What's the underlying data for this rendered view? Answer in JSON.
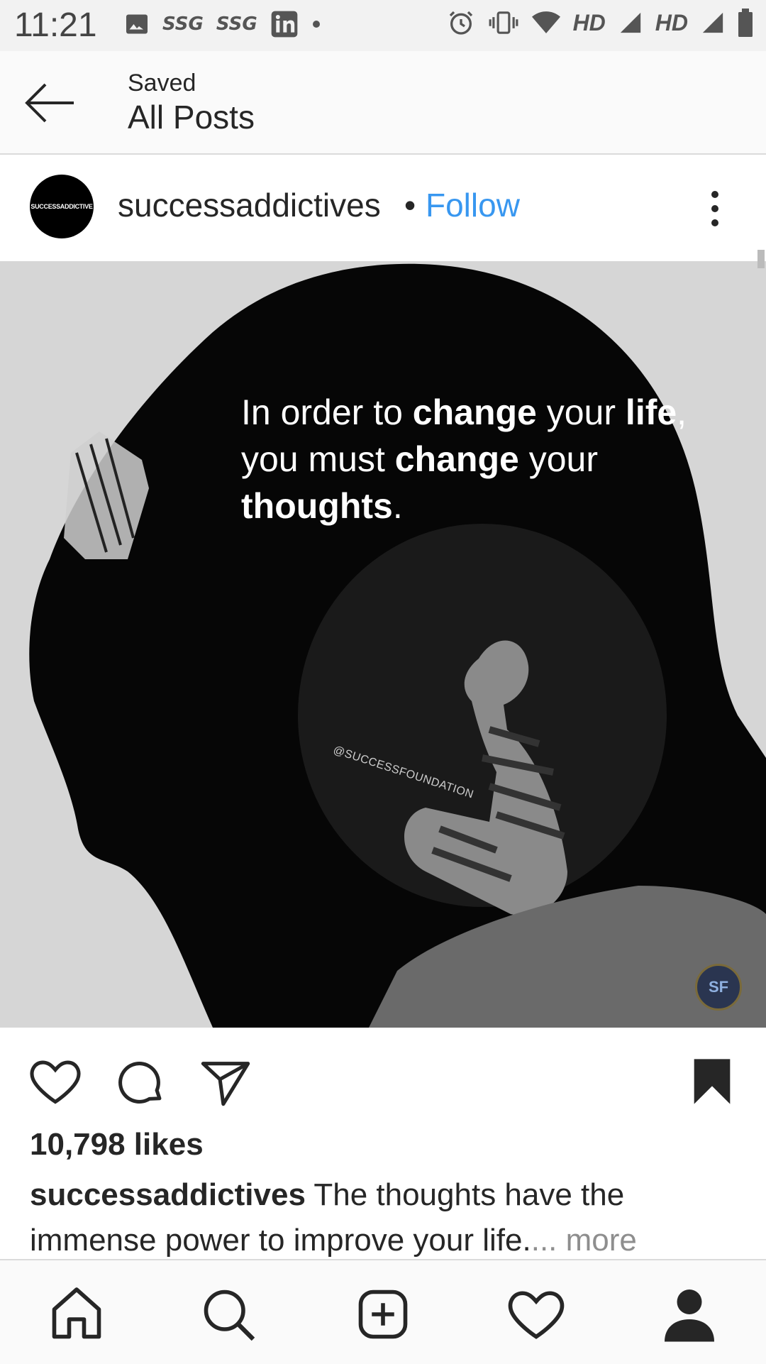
{
  "status_bar": {
    "time": "11:21",
    "indicators": [
      "SSG",
      "SSG"
    ],
    "network_labels": [
      "HD",
      "HD"
    ],
    "icons": [
      "image-icon",
      "linkedin-icon",
      "alarm-icon",
      "vibrate-icon",
      "wifi-icon",
      "signal-icon",
      "battery-icon"
    ]
  },
  "header": {
    "subtitle": "Saved",
    "title": "All Posts"
  },
  "post": {
    "avatar_text": "SUCCESSADDICTIVE",
    "username": "successaddictives",
    "separator": "•",
    "follow_label": "Follow",
    "image": {
      "quote_parts": [
        "In order to ",
        "change",
        " your ",
        "life",
        ", you must ",
        "change",
        " your ",
        "thoughts",
        "."
      ],
      "watermark": "@SUCCESSFOUNDATION",
      "badge": "SF"
    },
    "likes": "10,798 likes",
    "caption_user": "successaddictives",
    "caption_text": " The thoughts have the immense power to improve your life.",
    "caption_more": "... more"
  },
  "colors": {
    "link": "#3897f0",
    "text": "#262626",
    "muted": "#8e8e8e"
  }
}
